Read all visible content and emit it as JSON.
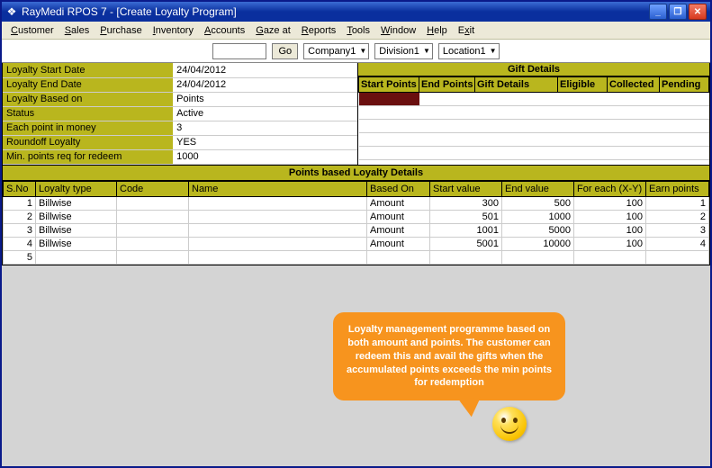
{
  "window": {
    "title": "RayMedi RPOS 7 - [Create Loyalty Program]"
  },
  "menu": {
    "items": [
      "Customer",
      "Sales",
      "Purchase",
      "Inventory",
      "Accounts",
      "Gaze at",
      "Reports",
      "Tools",
      "Window",
      "Help",
      "Exit"
    ],
    "mnemonic_index": [
      0,
      0,
      0,
      0,
      0,
      0,
      0,
      0,
      0,
      0,
      1
    ]
  },
  "toolbar": {
    "search_value": "",
    "go_label": "Go",
    "company": "Company1",
    "division": "Division1",
    "location": "Location1"
  },
  "left_props": [
    {
      "label": "Loyalty Start Date",
      "value": "24/04/2012"
    },
    {
      "label": "Loyalty End Date",
      "value": "24/04/2012"
    },
    {
      "label": "Loyalty Based on",
      "value": "Points"
    },
    {
      "label": "Status",
      "value": "Active"
    },
    {
      "label": "Each point in money",
      "value": "3"
    },
    {
      "label": "Roundoff Loyalty",
      "value": "YES"
    },
    {
      "label": "Min. points req for redeem",
      "value": "1000"
    }
  ],
  "gift": {
    "header": "Gift Details",
    "cols": [
      "Start Points",
      "End Points",
      "Gift Details",
      "Eligible",
      "Collected",
      "Pending"
    ]
  },
  "points": {
    "header": "Points based Loyalty Details",
    "cols": [
      "S.No",
      "Loyalty type",
      "Code",
      "Name",
      "Based On",
      "Start value",
      "End value",
      "For each (X-Y)",
      "Earn points"
    ],
    "rows": [
      {
        "sno": "1",
        "type": "Billwise",
        "code": "",
        "name": "",
        "based": "Amount",
        "start": "300",
        "end": "500",
        "each": "100",
        "earn": "1"
      },
      {
        "sno": "2",
        "type": "Billwise",
        "code": "",
        "name": "",
        "based": "Amount",
        "start": "501",
        "end": "1000",
        "each": "100",
        "earn": "2"
      },
      {
        "sno": "3",
        "type": "Billwise",
        "code": "",
        "name": "",
        "based": "Amount",
        "start": "1001",
        "end": "5000",
        "each": "100",
        "earn": "3"
      },
      {
        "sno": "4",
        "type": "Billwise",
        "code": "",
        "name": "",
        "based": "Amount",
        "start": "5001",
        "end": "10000",
        "each": "100",
        "earn": "4"
      },
      {
        "sno": "5",
        "type": "",
        "code": "",
        "name": "",
        "based": "",
        "start": "",
        "end": "",
        "each": "",
        "earn": ""
      }
    ]
  },
  "callout": {
    "text": "Loyalty management programme based on both amount and points. The customer can redeem this and avail the gifts when the accumulated points exceeds the min points for redemption"
  }
}
